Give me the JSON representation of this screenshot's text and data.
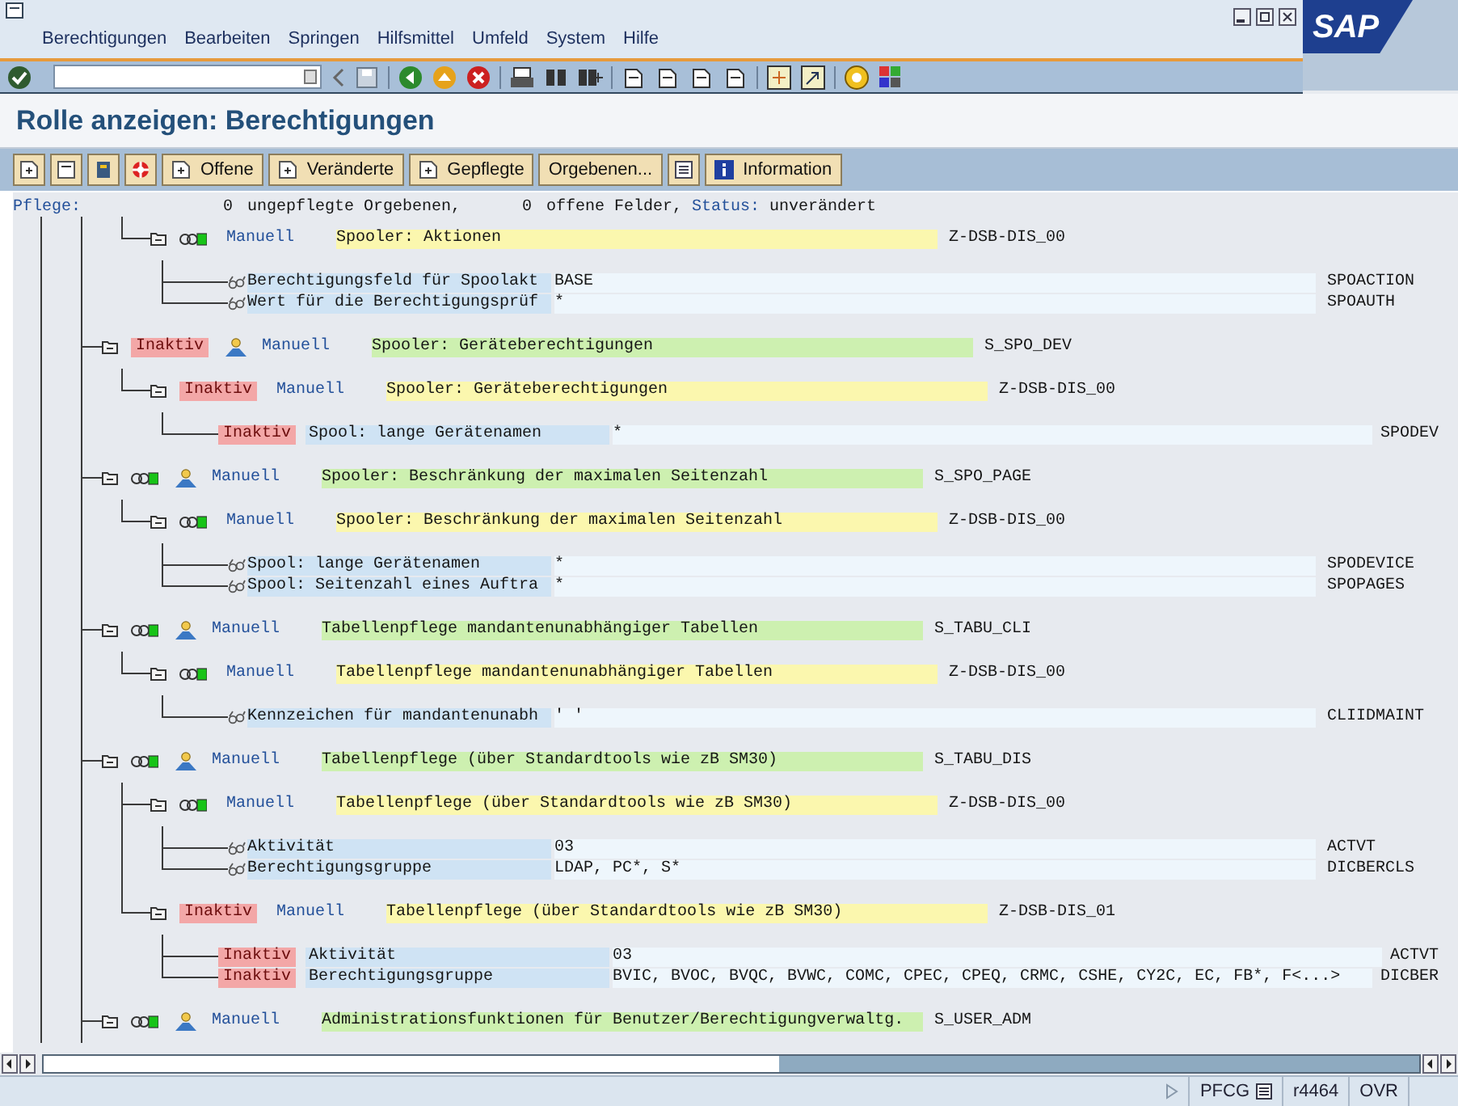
{
  "menu": [
    {
      "label": "Berechtigungen"
    },
    {
      "label": "Bearbeiten"
    },
    {
      "label": "Springen"
    },
    {
      "label": "Hilfsmittel"
    },
    {
      "label": "Umfeld"
    },
    {
      "label": "System"
    },
    {
      "label": "Hilfe"
    }
  ],
  "logo": "SAP",
  "title": "Rolle anzeigen: Berechtigungen",
  "app_toolbar": [
    {
      "label": "Offene"
    },
    {
      "label": "Veränderte"
    },
    {
      "label": "Gepflegte"
    },
    {
      "label": "Orgebenen..."
    },
    {
      "label": "Information"
    }
  ],
  "summary": {
    "label": "Pflege:",
    "unmaintained_count": "0",
    "unmaintained_text": "ungepflegte Orgebenen,",
    "open_count": "0",
    "open_text": "offene Felder,",
    "status_label": "Status:",
    "status_value": "unverändert"
  },
  "tree": [
    {
      "kind": "object",
      "maintenance": "Manuell",
      "description": "Spooler: Aktionen",
      "name": "Z-DSB-DIS_00",
      "children": [
        {
          "kind": "field",
          "label": "Berechtigungsfeld für Spoolakt",
          "value": "BASE",
          "technical_name": "SPOACTION"
        },
        {
          "kind": "field",
          "label": "Wert für die Berechtigungsprüf",
          "value": "*",
          "technical_name": "SPOAUTH"
        }
      ]
    },
    {
      "kind": "profile",
      "inactive_label": "Inaktiv",
      "maintenance": "Manuell",
      "description": "Spooler: Geräteberechtigungen",
      "name": "S_SPO_DEV",
      "children": [
        {
          "kind": "object",
          "inactive_label": "Inaktiv",
          "maintenance": "Manuell",
          "description": "Spooler: Geräteberechtigungen",
          "name": "Z-DSB-DIS_00",
          "children": [
            {
              "kind": "field",
              "inactive_label": "Inaktiv",
              "label": "Spool: lange Gerätenamen",
              "value": "*",
              "technical_name": "SPODEV"
            }
          ]
        }
      ]
    },
    {
      "kind": "profile",
      "maintenance": "Manuell",
      "description": "Spooler: Beschränkung der maximalen Seitenzahl",
      "name": "S_SPO_PAGE",
      "children": [
        {
          "kind": "object",
          "maintenance": "Manuell",
          "description": "Spooler: Beschränkung der maximalen Seitenzahl",
          "name": "Z-DSB-DIS_00",
          "children": [
            {
              "kind": "field",
              "label": "Spool: lange Gerätenamen",
              "value": "*",
              "technical_name": "SPODEVICE"
            },
            {
              "kind": "field",
              "label": "Spool: Seitenzahl eines Auftra",
              "value": "*",
              "technical_name": "SPOPAGES"
            }
          ]
        }
      ]
    },
    {
      "kind": "profile",
      "maintenance": "Manuell",
      "description": "Tabellenpflege mandantenunabhängiger Tabellen",
      "name": "S_TABU_CLI",
      "children": [
        {
          "kind": "object",
          "maintenance": "Manuell",
          "description": "Tabellenpflege mandantenunabhängiger Tabellen",
          "name": "Z-DSB-DIS_00",
          "children": [
            {
              "kind": "field",
              "label": "Kennzeichen für mandantenunabh",
              "value": "' '",
              "technical_name": "CLIIDMAINT"
            }
          ]
        }
      ]
    },
    {
      "kind": "profile",
      "maintenance": "Manuell",
      "description": "Tabellenpflege (über Standardtools wie zB SM30)",
      "name": "S_TABU_DIS",
      "children": [
        {
          "kind": "object",
          "maintenance": "Manuell",
          "description": "Tabellenpflege (über Standardtools wie zB SM30)",
          "name": "Z-DSB-DIS_00",
          "children": [
            {
              "kind": "field",
              "label": "Aktivität",
              "value": "03",
              "technical_name": "ACTVT"
            },
            {
              "kind": "field",
              "label": "Berechtigungsgruppe",
              "value": "LDAP, PC*, S*",
              "technical_name": "DICBERCLS"
            }
          ]
        },
        {
          "kind": "object",
          "inactive_label": "Inaktiv",
          "maintenance": "Manuell",
          "description": "Tabellenpflege (über Standardtools wie zB SM30)",
          "name": "Z-DSB-DIS_01",
          "children": [
            {
              "kind": "field",
              "inactive_label": "Inaktiv",
              "label": "Aktivität",
              "value": "03",
              "technical_name": "ACTVT"
            },
            {
              "kind": "field",
              "inactive_label": "Inaktiv",
              "label": "Berechtigungsgruppe",
              "value": "BVIC, BVOC, BVQC, BVWC, COMC, CPEC, CPEQ, CRMC, CSHE, CY2C, EC, FB*, F<...>",
              "technical_name": "DICBER"
            }
          ]
        }
      ]
    },
    {
      "kind": "profile",
      "maintenance": "Manuell",
      "description": "Administrationsfunktionen für Benutzer/Berechtigungverwaltg.",
      "name": "S_USER_ADM"
    }
  ],
  "status_bar": {
    "transaction": "PFCG",
    "server": "r4464",
    "mode": "OVR"
  }
}
